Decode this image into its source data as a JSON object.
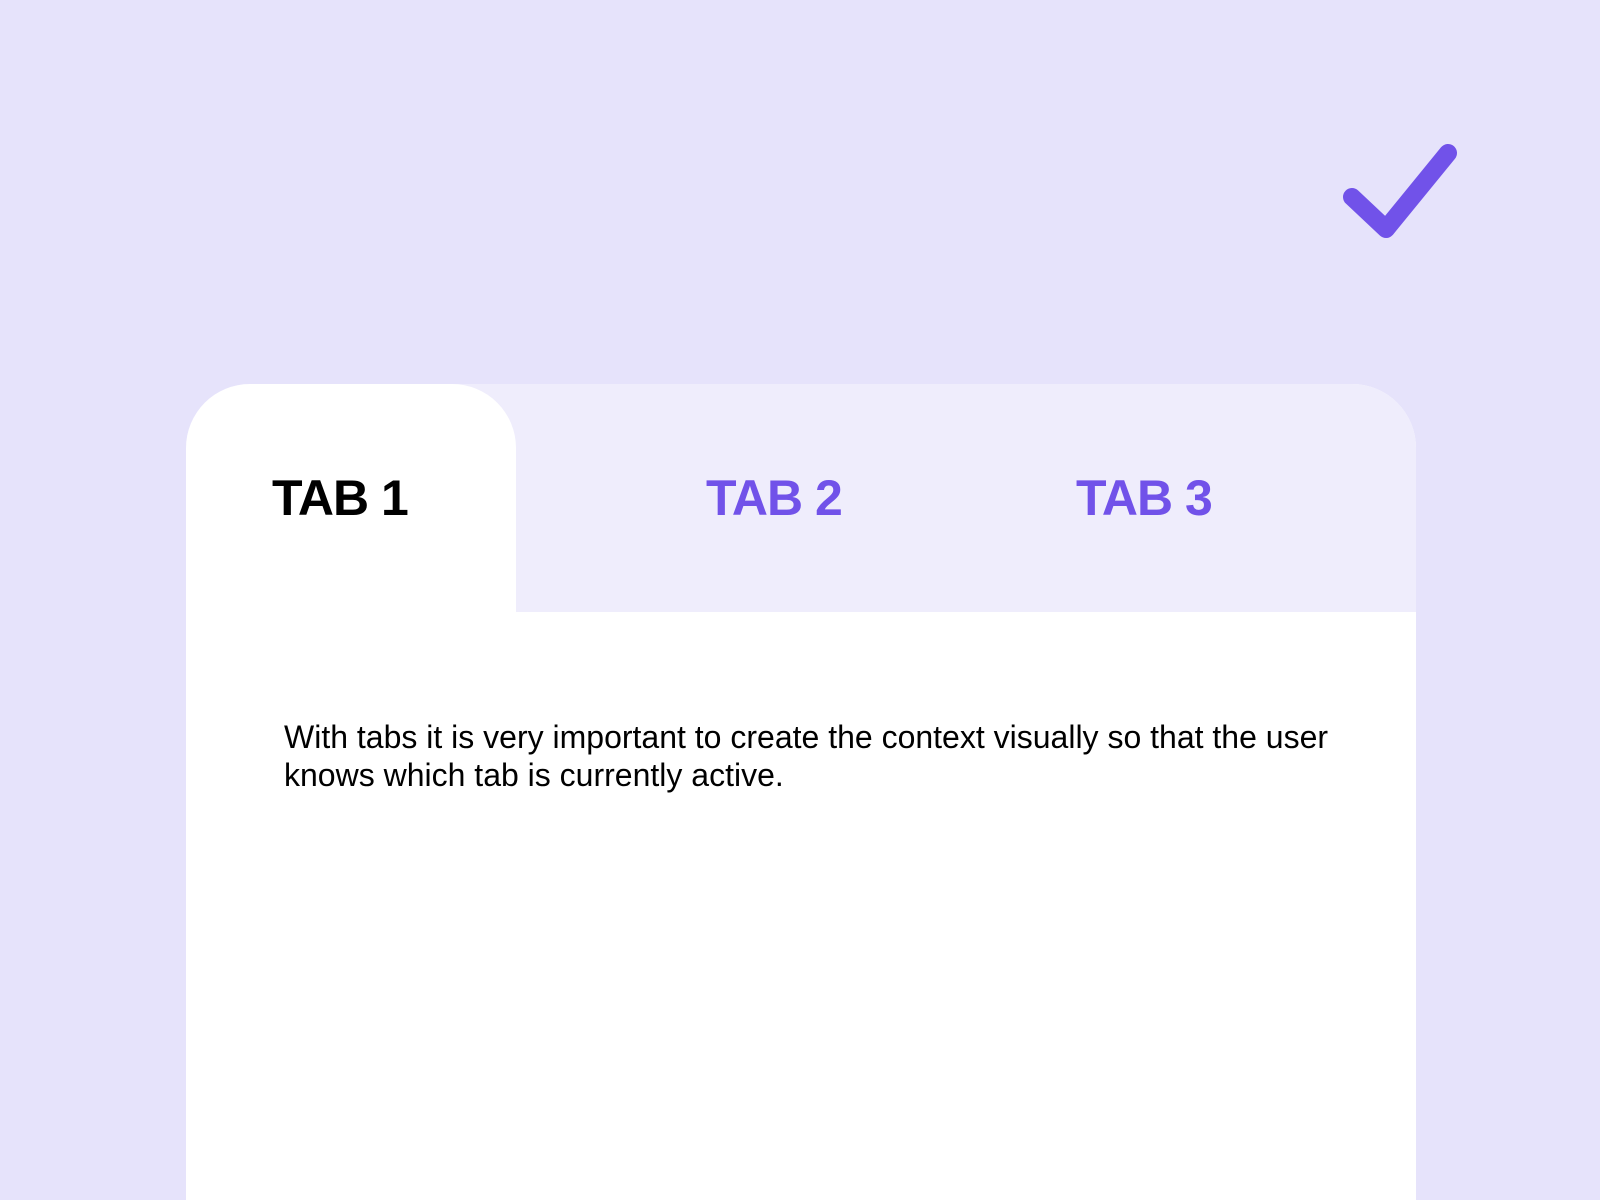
{
  "colors": {
    "background": "#e6e3fb",
    "tabbar": "#efedfc",
    "accent": "#7152e9",
    "active_tab_text": "#000000",
    "card": "#ffffff"
  },
  "status_icon": "check-icon",
  "tabs": [
    {
      "label": "TAB 1",
      "active": true
    },
    {
      "label": "TAB 2",
      "active": false
    },
    {
      "label": "TAB 3",
      "active": false
    }
  ],
  "content": {
    "text": "With tabs it is very important to create the context visually so that the user knows which tab is currently active."
  }
}
